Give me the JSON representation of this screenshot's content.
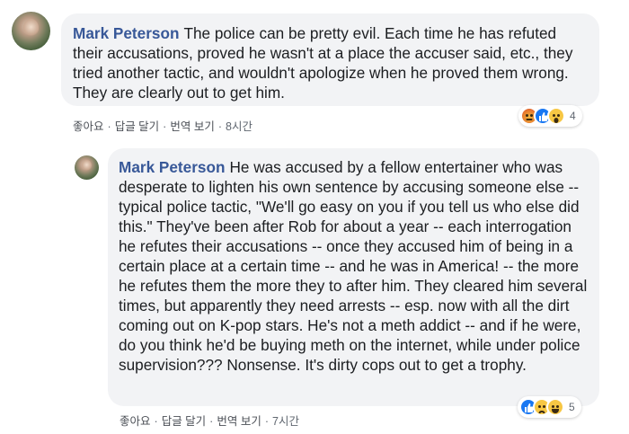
{
  "comments": [
    {
      "author": "Mark Peterson",
      "text": "The police can be pretty evil. Each time he has refuted their accusations, proved he wasn't at a place the accuser said, etc., they tried another tactic, and wouldn't apologize when he proved them wrong. They are clearly out to get him.",
      "actions": {
        "like": "좋아요",
        "reply": "답글 달기",
        "translate": "번역 보기",
        "time": "8시간",
        "separator": "·"
      },
      "reactions": {
        "icons": [
          "angry-icon",
          "like-icon",
          "wow-icon"
        ],
        "count": "4"
      }
    },
    {
      "author": "Mark Peterson",
      "text": "He was accused by a fellow entertainer who was desperate to lighten his own sentence by accusing someone else -- typical police tactic, \"We'll go easy on you if you tell us who else did this.\" They've been after Rob for about a year -- each interrogation he refutes their accusations -- once they accused him of being in a certain place at a certain time -- and he was in America! -- the more he refutes them the more they to after him. They cleared him several times, but apparently they need arrests -- esp. now with all the dirt coming out on K-pop stars. He's not a meth addict -- and if he were, do you think he'd be buying meth on the internet, while under police supervision??? Nonsense. It's dirty cops out to get a trophy.",
      "actions": {
        "like": "좋아요",
        "reply": "답글 달기",
        "translate": "번역 보기",
        "time": "7시간",
        "separator": "·"
      },
      "reactions": {
        "icons": [
          "like-icon",
          "sad-icon",
          "haha-icon"
        ],
        "count": "5"
      }
    }
  ]
}
